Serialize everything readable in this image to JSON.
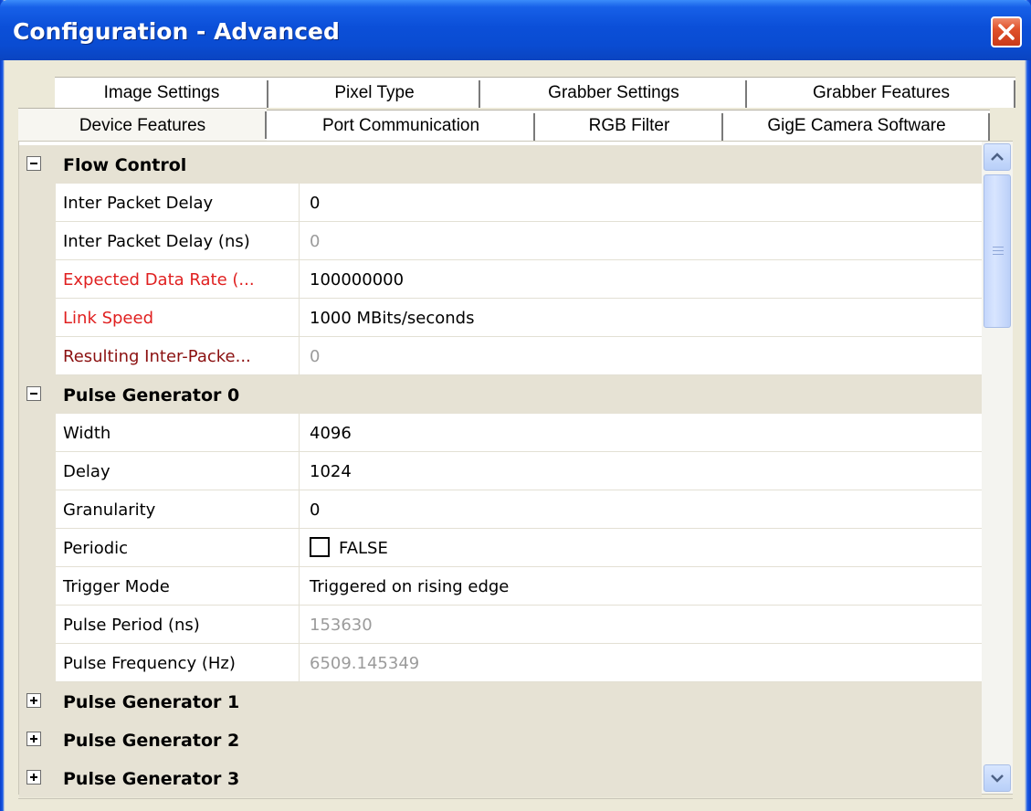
{
  "window": {
    "title": "Configuration - Advanced"
  },
  "tabs_row1": [
    {
      "label": "Image Settings"
    },
    {
      "label": "Pixel Type"
    },
    {
      "label": "Grabber Settings"
    },
    {
      "label": "Grabber Features"
    }
  ],
  "tabs_row2": [
    {
      "label": "Device Features",
      "selected": true
    },
    {
      "label": "Port Communication"
    },
    {
      "label": "RGB Filter"
    },
    {
      "label": "GigE Camera Software"
    }
  ],
  "grid": {
    "flow_control": {
      "title": "Flow Control",
      "expanded": true,
      "rows": [
        {
          "name": "Inter Packet Delay",
          "value": "0"
        },
        {
          "name": "Inter Packet Delay (ns)",
          "value": "0"
        },
        {
          "name": "Expected Data Rate (...",
          "value": "100000000"
        },
        {
          "name": "Link Speed",
          "value": "1000 MBits/seconds"
        },
        {
          "name": "Resulting Inter-Packe...",
          "value": "0"
        }
      ]
    },
    "pulse_generator_0": {
      "title": "Pulse Generator 0",
      "expanded": true,
      "rows": [
        {
          "name": "Width",
          "value": "4096"
        },
        {
          "name": "Delay",
          "value": "1024"
        },
        {
          "name": "Granularity",
          "value": "0"
        },
        {
          "name": "Periodic",
          "value": "FALSE"
        },
        {
          "name": "Trigger Mode",
          "value": "Triggered on rising edge"
        },
        {
          "name": "Pulse Period (ns)",
          "value": "153630"
        },
        {
          "name": "Pulse Frequency (Hz)",
          "value": "6509.145349"
        }
      ]
    },
    "pulse_generator_1": {
      "title": "Pulse Generator 1",
      "expanded": false
    },
    "pulse_generator_2": {
      "title": "Pulse Generator 2",
      "expanded": false
    },
    "pulse_generator_3": {
      "title": "Pulse Generator 3",
      "expanded": false
    }
  },
  "colors": {
    "title_bar": "#0a4cd2",
    "category_bg": "#e6e2d4",
    "required_label": "#e02020",
    "readonly_label": "#8b1010",
    "readonly_value": "#9b9b9b"
  }
}
